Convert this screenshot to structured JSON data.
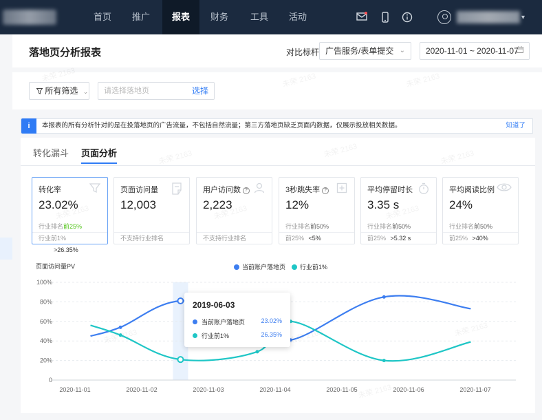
{
  "nav": {
    "items": [
      {
        "label": "首页",
        "active": false
      },
      {
        "label": "推广",
        "active": false
      },
      {
        "label": "报表",
        "active": true
      },
      {
        "label": "财务",
        "active": false
      },
      {
        "label": "工具",
        "active": false
      },
      {
        "label": "活动",
        "active": false
      }
    ],
    "icons": [
      "mail-icon",
      "mobile-icon",
      "info-icon"
    ],
    "user_caret": "▾"
  },
  "header": {
    "title": "落地页分析报表",
    "compare_label": "对比标杆",
    "compare_value": "广告服务/表单提交",
    "date_range": "2020-11-01 ~ 2020-11-07"
  },
  "filter": {
    "button_label": "所有筛选",
    "input_placeholder": "请选择落地页",
    "select_label": "选择"
  },
  "notice": {
    "text": "本报表的所有分析针对的是在投落地页的广告流量，不包括自然流量；第三方落地页缺乏页面内数据，仅展示投放相关数据。",
    "link": "知道了"
  },
  "tabs": [
    {
      "label": "转化漏斗",
      "active": false
    },
    {
      "label": "页面分析",
      "active": true
    }
  ],
  "cards": [
    {
      "title": "转化率",
      "value": "23.02%",
      "rank_prefix": "行业排名",
      "rank": "前25%",
      "rank_green": true,
      "foot_label": "行业前1%",
      "foot_value": ">26.35%",
      "icon": "funnel-icon",
      "selected": true,
      "help": false
    },
    {
      "title": "页面访问量",
      "value": "12,003",
      "rank_prefix": "",
      "rank": "",
      "rank_green": false,
      "foot_label": "不支持行业排名",
      "foot_value": "",
      "icon": "page-icon",
      "selected": false,
      "help": false
    },
    {
      "title": "用户访问数",
      "value": "2,223",
      "rank_prefix": "",
      "rank": "",
      "rank_green": false,
      "foot_label": "不支持行业排名",
      "foot_value": "",
      "icon": "user-icon",
      "selected": false,
      "help": true
    },
    {
      "title": "3秒跳失率",
      "value": "12%",
      "rank_prefix": "行业排名",
      "rank": "前50%",
      "rank_green": false,
      "foot_label": "前25%",
      "foot_value": "<5%",
      "icon": "exit-icon",
      "selected": false,
      "help": true
    },
    {
      "title": "平均停留时长",
      "value": "3.35 s",
      "rank_prefix": "行业排名",
      "rank": "前50%",
      "rank_green": false,
      "foot_label": "前25%",
      "foot_value": ">5.32 s",
      "icon": "stopwatch-icon",
      "selected": false,
      "help": false
    },
    {
      "title": "平均阅读比例",
      "value": "24%",
      "rank_prefix": "行业排名",
      "rank": "前50%",
      "rank_green": false,
      "foot_label": "前25%",
      "foot_value": ">40%",
      "icon": "eye-icon",
      "selected": false,
      "help": false
    }
  ],
  "chart_data": {
    "type": "line",
    "title": "页面访问量PV",
    "categories": [
      "2020-11-01",
      "2020-11-02",
      "2020-11-03",
      "2020-11-04",
      "2020-11-05",
      "2020-11-06",
      "2020-11-07"
    ],
    "ylim": [
      0,
      100
    ],
    "yticks": [
      "0",
      "20%",
      "40%",
      "60%",
      "80%",
      "100%"
    ],
    "grid": true,
    "legend_position": "top-right",
    "series": [
      {
        "name": "当前账户落地页",
        "color": "#3d7ef0",
        "x": [
          1.0,
          1.45,
          2.35,
          3.5,
          4.0,
          5.4,
          6.7
        ],
        "values": [
          45,
          54,
          81,
          64,
          41,
          85,
          73
        ]
      },
      {
        "name": "行业前1%",
        "color": "#1fc6c6",
        "x": [
          1.0,
          1.45,
          2.35,
          3.5,
          4.0,
          5.4,
          6.7
        ],
        "values": [
          56,
          46,
          21,
          29,
          60,
          20,
          39
        ]
      }
    ],
    "tooltip": {
      "date": "2019-06-03",
      "rows": [
        {
          "name": "当前账户落地页",
          "value": "23.02%"
        },
        {
          "name": "行业前1%",
          "value": "26.35%"
        }
      ]
    }
  },
  "watermark": "未荣 2163"
}
